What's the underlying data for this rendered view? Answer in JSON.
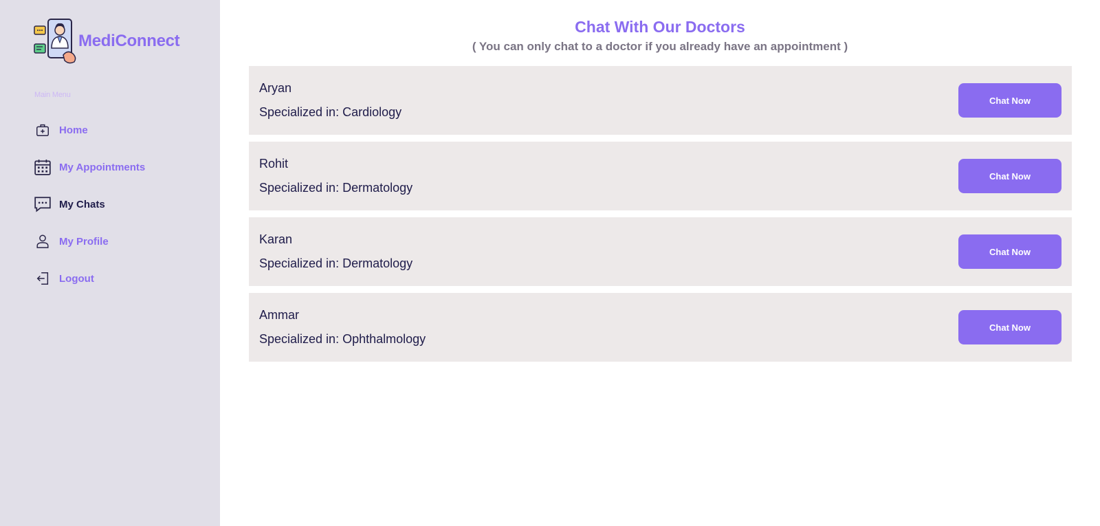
{
  "brand": {
    "name": "MediConnect",
    "logo_icon": "doctor-on-phone-icon"
  },
  "sidebar": {
    "caption": "Main Menu",
    "items": [
      {
        "label": "Home",
        "icon": "medical-bag-icon",
        "active": false
      },
      {
        "label": "My Appointments",
        "icon": "calendar-icon",
        "active": false
      },
      {
        "label": "My Chats",
        "icon": "chat-bubble-icon",
        "active": true
      },
      {
        "label": "My Profile",
        "icon": "user-icon",
        "active": false
      },
      {
        "label": "Logout",
        "icon": "logout-icon",
        "active": false
      }
    ]
  },
  "main": {
    "title": "Chat With Our Doctors",
    "subtitle": "( You can only chat to a doctor if you already have an appointment )",
    "doctors": [
      {
        "name": "Aryan",
        "specialization": "Specialized in: Cardiology",
        "button": "Chat Now"
      },
      {
        "name": "Rohit",
        "specialization": "Specialized in: Dermatology",
        "button": "Chat Now"
      },
      {
        "name": "Karan",
        "specialization": "Specialized in: Dermatology",
        "button": "Chat Now"
      },
      {
        "name": "Ammar",
        "specialization": "Specialized in: Ophthalmology",
        "button": "Chat Now"
      }
    ]
  },
  "colors": {
    "accent": "#8a6cf0",
    "sidebar_bg": "#e1dfe8",
    "card_bg": "#ede9e9",
    "text_dark": "#1f1c4a",
    "subtitle": "#7a7484"
  }
}
